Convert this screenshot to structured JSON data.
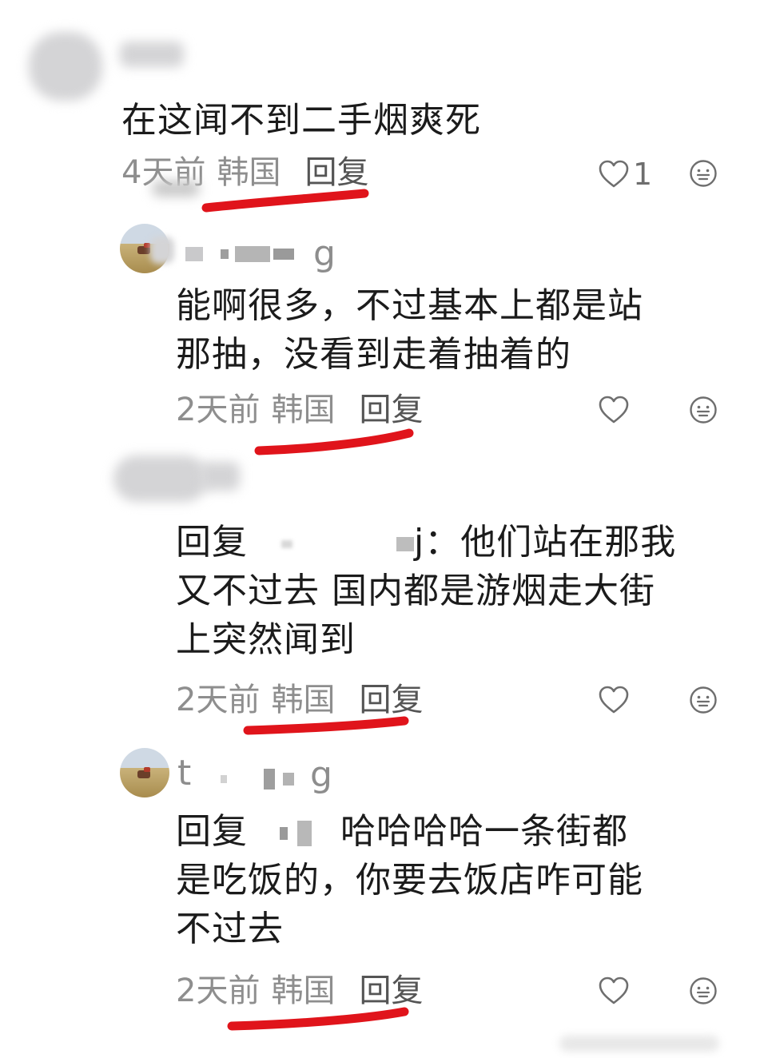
{
  "comments": [
    {
      "text_lines": [
        "在这闻不到二手烟爽死"
      ],
      "time": "4天前",
      "location": "韩国",
      "reply_label": "回复",
      "like_count": "1"
    },
    {
      "username_visible": "g",
      "text_lines": [
        "能啊很多，不过基本上都是站",
        "那抽，没看到走着抽着的"
      ],
      "time": "2天前",
      "location": "韩国",
      "reply_label": "回复"
    },
    {
      "reply_prefix": "回复",
      "reply_target_visible": "j：",
      "text_lines_rest": [
        "他们站在那我",
        "又不过去 国内都是游烟走大街",
        "上突然闻到"
      ],
      "time": "2天前",
      "location": "韩国",
      "reply_label": "回复"
    },
    {
      "username_visible_start": "t",
      "username_visible_end": "g",
      "reply_prefix": "回复",
      "text_lines_rest": [
        "哈哈哈哈一条街都",
        "是吃饭的，你要去饭店咋可能",
        "不过去"
      ],
      "time": "2天前",
      "location": "韩国",
      "reply_label": "回复"
    }
  ],
  "icons": {
    "like": "heart-outline-icon",
    "emoji": "neutral-face-icon"
  },
  "colors": {
    "underline": "#e0141b",
    "meta": "#8e8e8e",
    "text": "#1b1b1b"
  }
}
